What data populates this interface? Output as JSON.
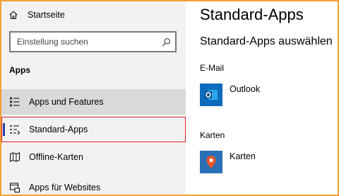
{
  "sidebar": {
    "home_label": "Startseite",
    "search_placeholder": "Einstellung suchen",
    "section_label": "Apps",
    "items": [
      {
        "label": "Apps und Features",
        "icon": "list-icon"
      },
      {
        "label": "Standard-Apps",
        "icon": "default-apps-icon"
      },
      {
        "label": "Offline-Karten",
        "icon": "offline-map-icon"
      },
      {
        "label": "Apps für Websites",
        "icon": "website-app-icon"
      }
    ]
  },
  "main": {
    "title": "Standard-Apps",
    "subtitle": "Standard-Apps auswählen",
    "email_label": "E-Mail",
    "email_app": "Outlook",
    "maps_label": "Karten",
    "maps_app": "Karten"
  },
  "colors": {
    "accent": "#2b3fa8",
    "selection_border": "#e02020",
    "frame": "#f0a030",
    "outlook_tile": "#0f6cbd",
    "maps_tile": "#2b6fb6"
  }
}
